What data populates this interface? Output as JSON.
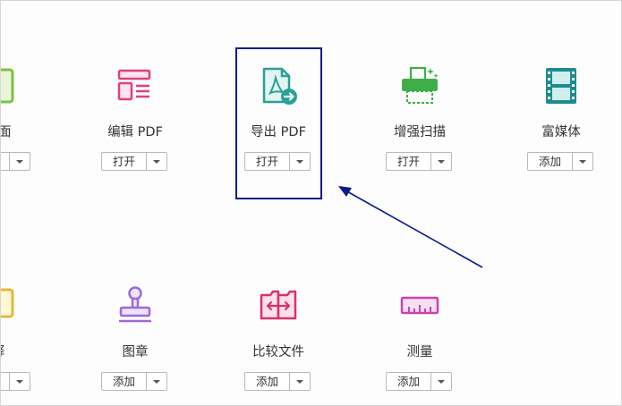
{
  "tools": [
    {
      "id": "page",
      "label": "页面",
      "action": "",
      "icon": "page-icon"
    },
    {
      "id": "edit-pdf",
      "label": "编辑 PDF",
      "action": "打开",
      "icon": "edit-pdf-icon"
    },
    {
      "id": "export-pdf",
      "label": "导出 PDF",
      "action": "打开",
      "icon": "export-pdf-icon"
    },
    {
      "id": "enhance-scan",
      "label": "增强扫描",
      "action": "打开",
      "icon": "scanner-icon"
    },
    {
      "id": "rich-media",
      "label": "富媒体",
      "action": "添加",
      "icon": "film-icon"
    },
    {
      "id": "annotate",
      "label": "释",
      "action": "",
      "icon": "annotate-icon"
    },
    {
      "id": "stamp",
      "label": "图章",
      "action": "添加",
      "icon": "stamp-icon"
    },
    {
      "id": "compare",
      "label": "比较文件",
      "action": "添加",
      "icon": "compare-icon"
    },
    {
      "id": "measure",
      "label": "测量",
      "action": "添加",
      "icon": "ruler-icon"
    }
  ],
  "colors": {
    "highlight": "#0c1a8c",
    "edit": "#e0407c",
    "export": "#2aa096",
    "scan": "#3fae49",
    "media": "#1f8c8c",
    "stamp": "#9c6ad8",
    "compare": "#d6336c",
    "measure": "#c844b0"
  }
}
